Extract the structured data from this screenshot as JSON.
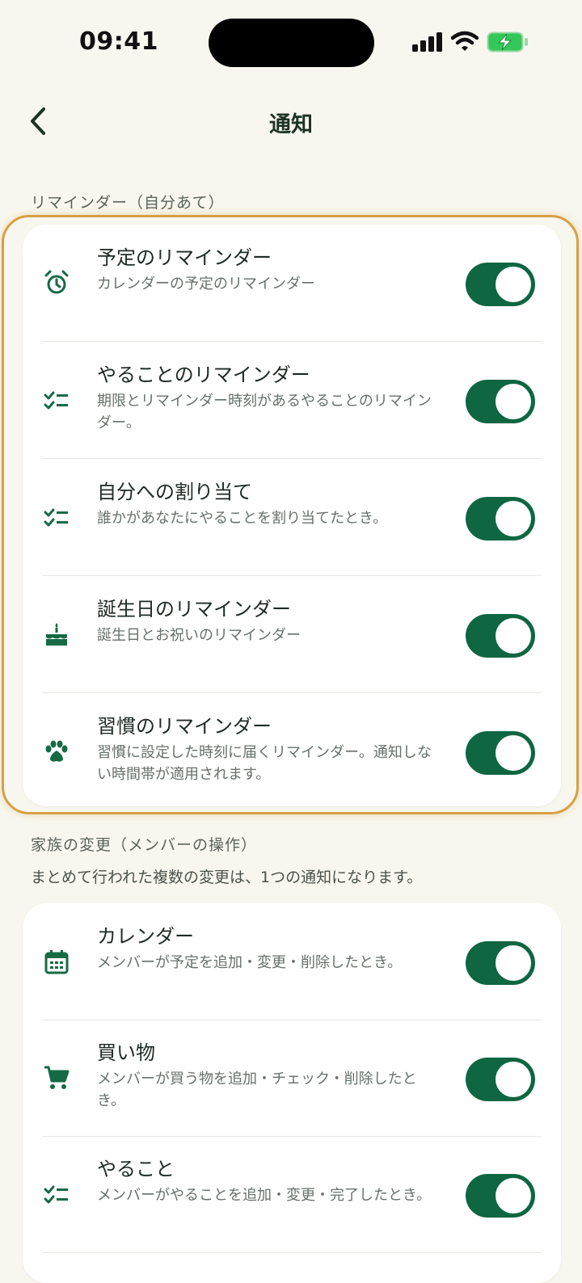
{
  "status": {
    "time": "09:41"
  },
  "nav": {
    "title": "通知"
  },
  "reminders": {
    "header": "リマインダー（自分あて）",
    "items": [
      {
        "icon": "alarm-clock-icon",
        "title": "予定のリマインダー",
        "desc": "カレンダーの予定のリマインダー",
        "enabled": true
      },
      {
        "icon": "checklist-icon",
        "title": "やることのリマインダー",
        "desc": "期限とリマインダー時刻があるやることのリマインダー。",
        "enabled": true
      },
      {
        "icon": "checklist-icon",
        "title": "自分への割り当て",
        "desc": "誰かがあなたにやることを割り当てたとき。",
        "enabled": true
      },
      {
        "icon": "cake-icon",
        "title": "誕生日のリマインダー",
        "desc": "誕生日とお祝いのリマインダー",
        "enabled": true
      },
      {
        "icon": "paw-icon",
        "title": "習慣のリマインダー",
        "desc": "習慣に設定した時刻に届くリマインダー。通知しない時間帯が適用されます。",
        "enabled": true
      }
    ]
  },
  "family": {
    "header": "家族の変更（メンバーの操作）",
    "note": "まとめて行われた複数の変更は、1つの通知になります。",
    "items": [
      {
        "icon": "calendar-icon",
        "title": "カレンダー",
        "desc": "メンバーが予定を追加・変更・削除したとき。",
        "enabled": true
      },
      {
        "icon": "cart-icon",
        "title": "買い物",
        "desc": "メンバーが買う物を追加・チェック・削除したとき。",
        "enabled": true
      },
      {
        "icon": "checklist-icon",
        "title": "やること",
        "desc": "メンバーがやることを追加・変更・完了したとき。",
        "enabled": true
      }
    ]
  },
  "colors": {
    "accent": "#0f6642",
    "background": "#f8f7ef",
    "highlight": "#d8a044"
  }
}
